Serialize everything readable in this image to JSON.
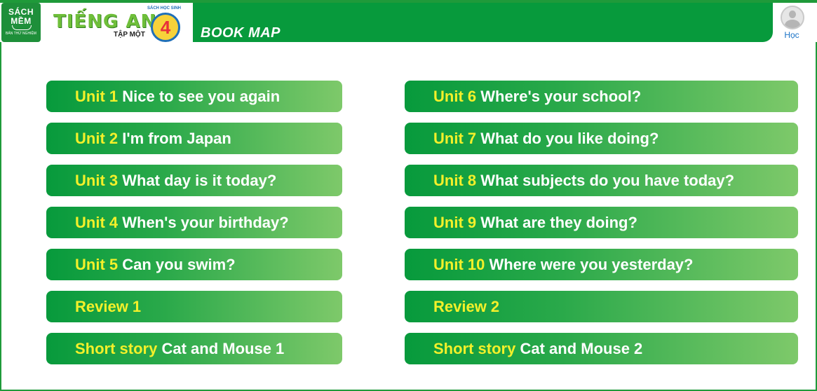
{
  "header": {
    "brand_line1": "SÁCH",
    "brand_line2": "MỀM",
    "brand_line3": "BẢN THỬ NGHIỆM",
    "book_title": "TIẾNG ANH",
    "book_volume": "TẬP MỘT",
    "book_grade": "4",
    "book_series": "SÁCH HỌC SINH",
    "page_title": "BOOK MAP",
    "user_label": "Học"
  },
  "units_left": [
    {
      "label": "Unit 1",
      "title": "Nice to see you again"
    },
    {
      "label": "Unit 2",
      "title": "I'm from Japan"
    },
    {
      "label": "Unit 3",
      "title": "What day is it today?"
    },
    {
      "label": "Unit 4",
      "title": "When's your birthday?"
    },
    {
      "label": "Unit 5",
      "title": "Can you swim?"
    },
    {
      "label": "Review 1",
      "title": ""
    },
    {
      "label": "Short story",
      "title": "Cat and Mouse 1"
    }
  ],
  "units_right": [
    {
      "label": "Unit 6",
      "title": "Where's your school?"
    },
    {
      "label": "Unit 7",
      "title": "What do you like doing?"
    },
    {
      "label": "Unit 8",
      "title": "What subjects do you have today?"
    },
    {
      "label": "Unit 9",
      "title": "What are they doing?"
    },
    {
      "label": "Unit 10",
      "title": "Where were you yesterday?"
    },
    {
      "label": "Review 2",
      "title": ""
    },
    {
      "label": "Short story",
      "title": "Cat and Mouse 2"
    }
  ],
  "colors": {
    "brand_green": "#079a3c",
    "label_yellow": "#f3f02a",
    "user_link": "#1a73c7"
  }
}
